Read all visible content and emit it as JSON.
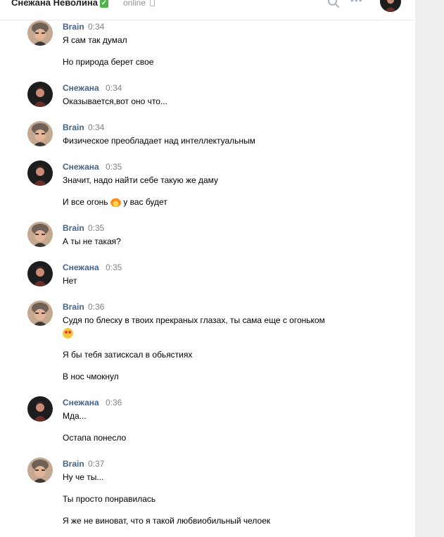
{
  "header": {
    "name": "Снежана Неволина",
    "status": "online",
    "more_label": "•••"
  },
  "messages": [
    {
      "author": "Brain",
      "time": "0:34",
      "lines": [
        "Я сам так думал",
        "Но природа берет свое"
      ]
    },
    {
      "author": "Снежана",
      "time": "0:34",
      "lines": [
        "Оказывается,вот оно что..."
      ]
    },
    {
      "author": "Brain",
      "time": "0:34",
      "lines": [
        "Физическое преобладает над интеллектуальным"
      ]
    },
    {
      "author": "Снежана",
      "time": "0:35",
      "lines": [
        "Значит, надо найти себе такую же даму",
        "И все огонь",
        "у вас будет"
      ]
    },
    {
      "author": "Brain",
      "time": "0:35",
      "lines": [
        "А ты не такая?"
      ]
    },
    {
      "author": "Снежана",
      "time": "0:35",
      "lines": [
        "Нет"
      ]
    },
    {
      "author": "Brain",
      "time": "0:36",
      "lines": [
        "Судя по блеску в твоих прекраных глазах, ты сама еще с огоньком",
        "Я бы тебя затисксал в обьястиях",
        "В нос чмокнул"
      ]
    },
    {
      "author": "Снежана",
      "time": "0:36",
      "lines": [
        "Мда...",
        "Остапа понесло"
      ]
    },
    {
      "author": "Brain",
      "time": "0:37",
      "lines": [
        "Ну че ты...",
        "Ты просто понравилась",
        "Я же не виноват, что я такой любвиобильный челоек"
      ]
    }
  ],
  "icons": {
    "verified": "check-badge-icon",
    "phone": "mobile-phone-icon",
    "search": "search-icon",
    "more": "more-dots-icon",
    "fire": "fire-emoji-icon",
    "heart_eyes": "heart-eyes-emoji-icon"
  }
}
